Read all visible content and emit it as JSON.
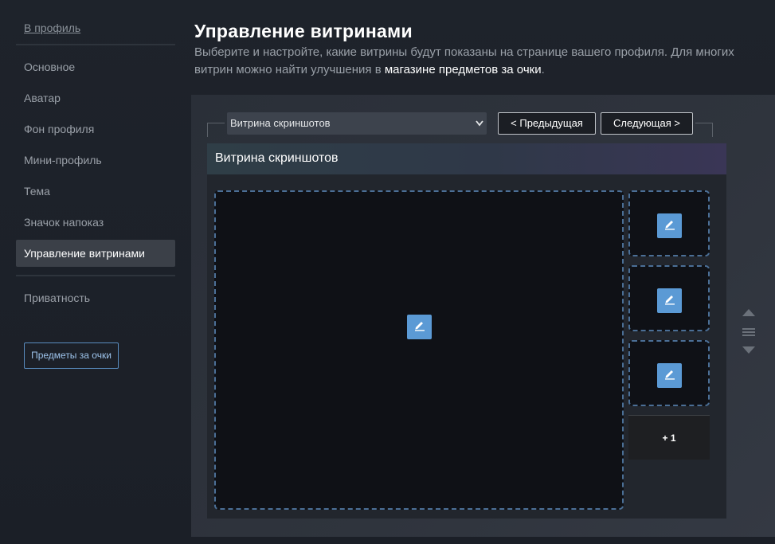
{
  "sidebar": {
    "back_link": "В профиль",
    "items": [
      {
        "label": "Основное"
      },
      {
        "label": "Аватар"
      },
      {
        "label": "Фон профиля"
      },
      {
        "label": "Мини-профиль"
      },
      {
        "label": "Тема"
      },
      {
        "label": "Значок напоказ"
      },
      {
        "label": "Управление витринами",
        "active": true
      },
      {
        "label": "Приватность"
      }
    ],
    "points_button": "Предметы за очки"
  },
  "header": {
    "title": "Управление витринами",
    "desc_part1": "Выберите и настройте, какие витрины будут показаны на странице вашего профиля. Для многих витрин можно найти улучшения в ",
    "desc_link": "магазине предметов за очки",
    "desc_part2": "."
  },
  "showcase": {
    "selected": "Витрина скриншотов",
    "prev_button": "< Предыдущая",
    "next_button": "Следующая >",
    "title": "Витрина скриншотов",
    "extra_count": "+ 1",
    "icons": {
      "edit": "pencil-icon",
      "move_up": "arrow-up-icon",
      "drag": "drag-handle-icon",
      "move_down": "arrow-down-icon"
    },
    "colors": {
      "accent": "#5b9ad5",
      "slot_border": "#4b6f96"
    }
  }
}
